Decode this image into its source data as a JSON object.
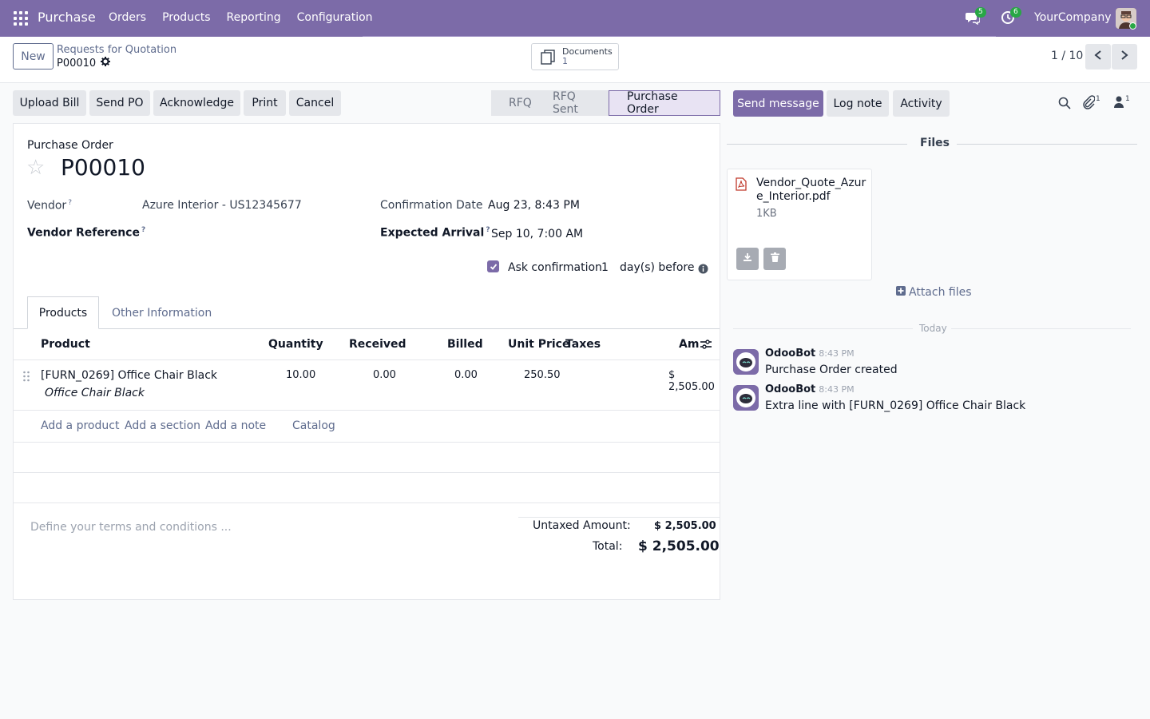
{
  "navbar": {
    "app_name": "Purchase",
    "menu": [
      "Orders",
      "Products",
      "Reporting",
      "Configuration"
    ],
    "messages_badge": "5",
    "activities_badge": "6",
    "company": "YourCompany"
  },
  "control_panel": {
    "new_label": "New",
    "breadcrumb_parent": "Requests for Quotation",
    "breadcrumb_current": "P00010",
    "documents_label": "Documents",
    "documents_count": "1",
    "pager": "1 / 10"
  },
  "actions": {
    "upload_bill": "Upload Bill",
    "send_po": "Send PO",
    "acknowledge": "Acknowledge",
    "print": "Print",
    "cancel": "Cancel"
  },
  "status": {
    "stages": [
      "RFQ",
      "RFQ Sent",
      "Purchase Order"
    ],
    "active": "Purchase Order"
  },
  "chatter_actions": {
    "send_message": "Send message",
    "log_note": "Log note",
    "activity": "Activity",
    "attachments_count": "1",
    "followers_count": "1"
  },
  "form": {
    "subtitle": "Purchase Order",
    "title": "P00010",
    "vendor_label": "Vendor",
    "vendor_value": "Azure Interior - US12345677",
    "vendor_ref_label": "Vendor Reference",
    "confirmation_label": "Confirmation Date",
    "confirmation_value": "Aug 23, 8:43 PM",
    "expected_label": "Expected Arrival",
    "expected_value": "Sep 10, 7:00 AM",
    "ask_label": "Ask confirmation",
    "ask_days": "1",
    "ask_suffix": "day(s) before",
    "help_mark": "?"
  },
  "tabs": {
    "products": "Products",
    "other": "Other Information"
  },
  "table": {
    "headers": {
      "product": "Product",
      "quantity": "Quantity",
      "received": "Received",
      "billed": "Billed",
      "unit_price": "Unit Price",
      "taxes": "Taxes",
      "amount": "Am"
    },
    "rows": [
      {
        "product": "[FURN_0269] Office Chair Black",
        "description": "Office Chair Black",
        "quantity": "10.00",
        "received": "0.00",
        "billed": "0.00",
        "unit_price": "250.50",
        "amount": "$ 2,505.00"
      }
    ],
    "add_product": "Add a product",
    "add_section": "Add a section",
    "add_note": "Add a note",
    "catalog": "Catalog"
  },
  "footer": {
    "terms_placeholder": "Define your terms and conditions ...",
    "untaxed_label": "Untaxed Amount:",
    "untaxed_value": "$ 2,505.00",
    "total_label": "Total:",
    "total_value": "$ 2,505.00"
  },
  "chatter": {
    "files_title": "Files",
    "file_name": "Vendor_Quote_Azure_Interior.pdf",
    "file_size": "1KB",
    "attach_label": "Attach files",
    "today_label": "Today",
    "messages": [
      {
        "author": "OdooBot",
        "time": "8:43 PM",
        "body": "Purchase Order created"
      },
      {
        "author": "OdooBot",
        "time": "8:43 PM",
        "body": "Extra line with [FURN_0269] Office Chair Black"
      }
    ]
  },
  "colors": {
    "brand": "#7c6ba8",
    "link": "#5f6c8e",
    "badge": "#28a745"
  }
}
